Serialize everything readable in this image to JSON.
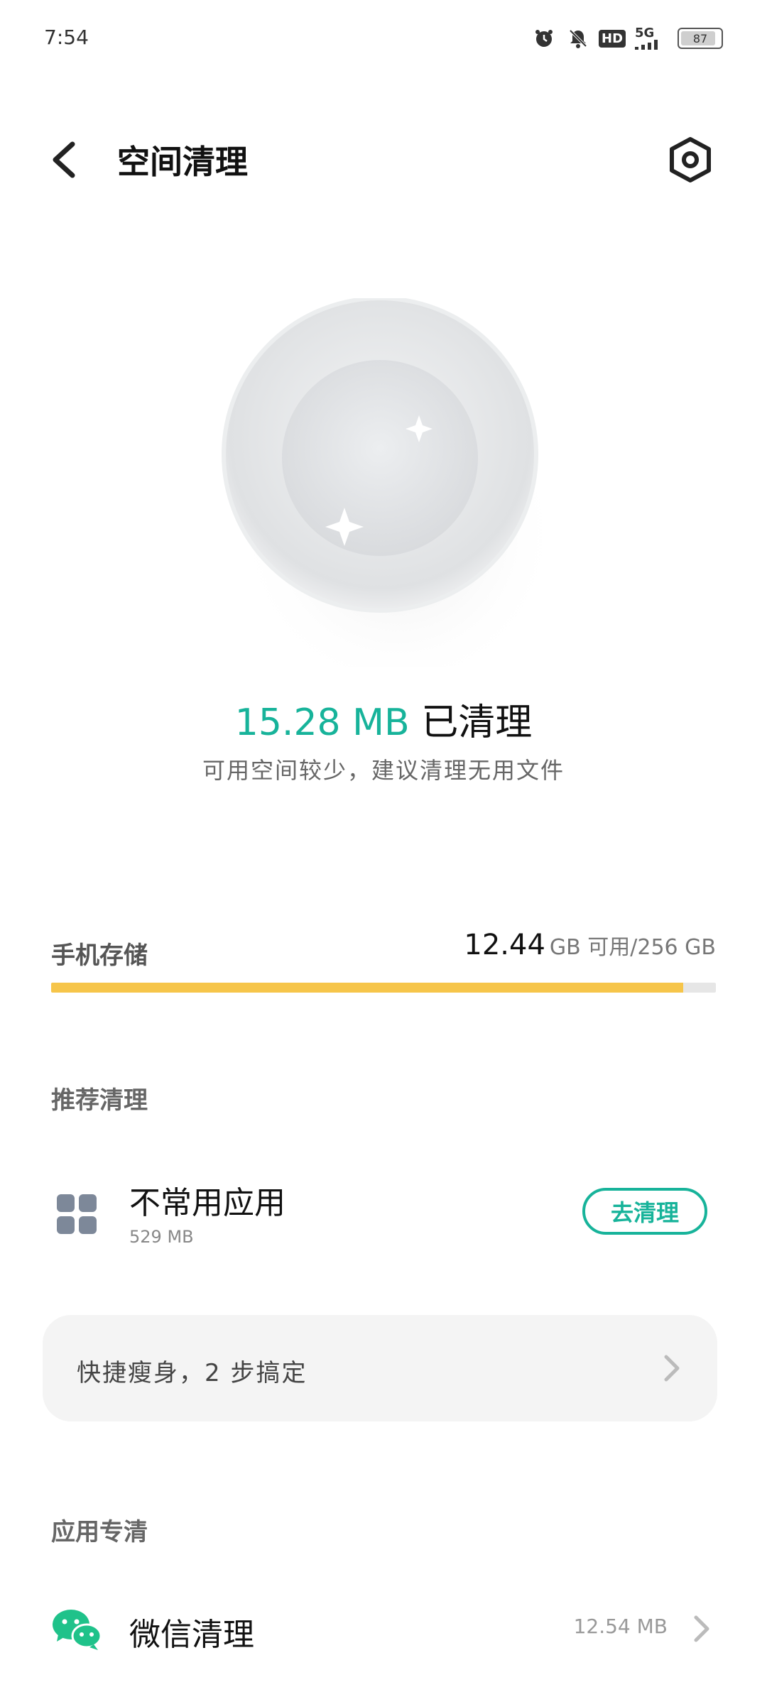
{
  "status_bar": {
    "time": "7:54",
    "network": "5G",
    "hd": "HD",
    "battery_level": "87",
    "icons": [
      "alarm-icon",
      "mute-icon",
      "hd-icon",
      "5g-signal-icon",
      "battery-icon"
    ]
  },
  "header": {
    "title": "空间清理",
    "back_icon": "chevron-left-icon",
    "settings_icon": "settings-hex-icon"
  },
  "hero": {
    "cleaned_size": "15.28 MB",
    "cleaned_label": "已清理",
    "subtitle": "可用空间较少，建议清理无用文件"
  },
  "storage": {
    "label": "手机存储",
    "available": "12.44",
    "unit_and_total": "GB 可用/256 GB",
    "used_fraction": 0.951,
    "bar_color": "#f6c54a"
  },
  "recommend": {
    "section_title": "推荐清理",
    "item_title": "不常用应用",
    "item_size": "529 MB",
    "button_label": "去清理",
    "accent_color": "#17b39a"
  },
  "quick": {
    "text": "快捷瘦身，2 步搞定"
  },
  "app_clean": {
    "section_title": "应用专清",
    "wechat_title": "微信清理",
    "wechat_size": "12.54 MB",
    "wechat_color": "#1fc28a"
  }
}
